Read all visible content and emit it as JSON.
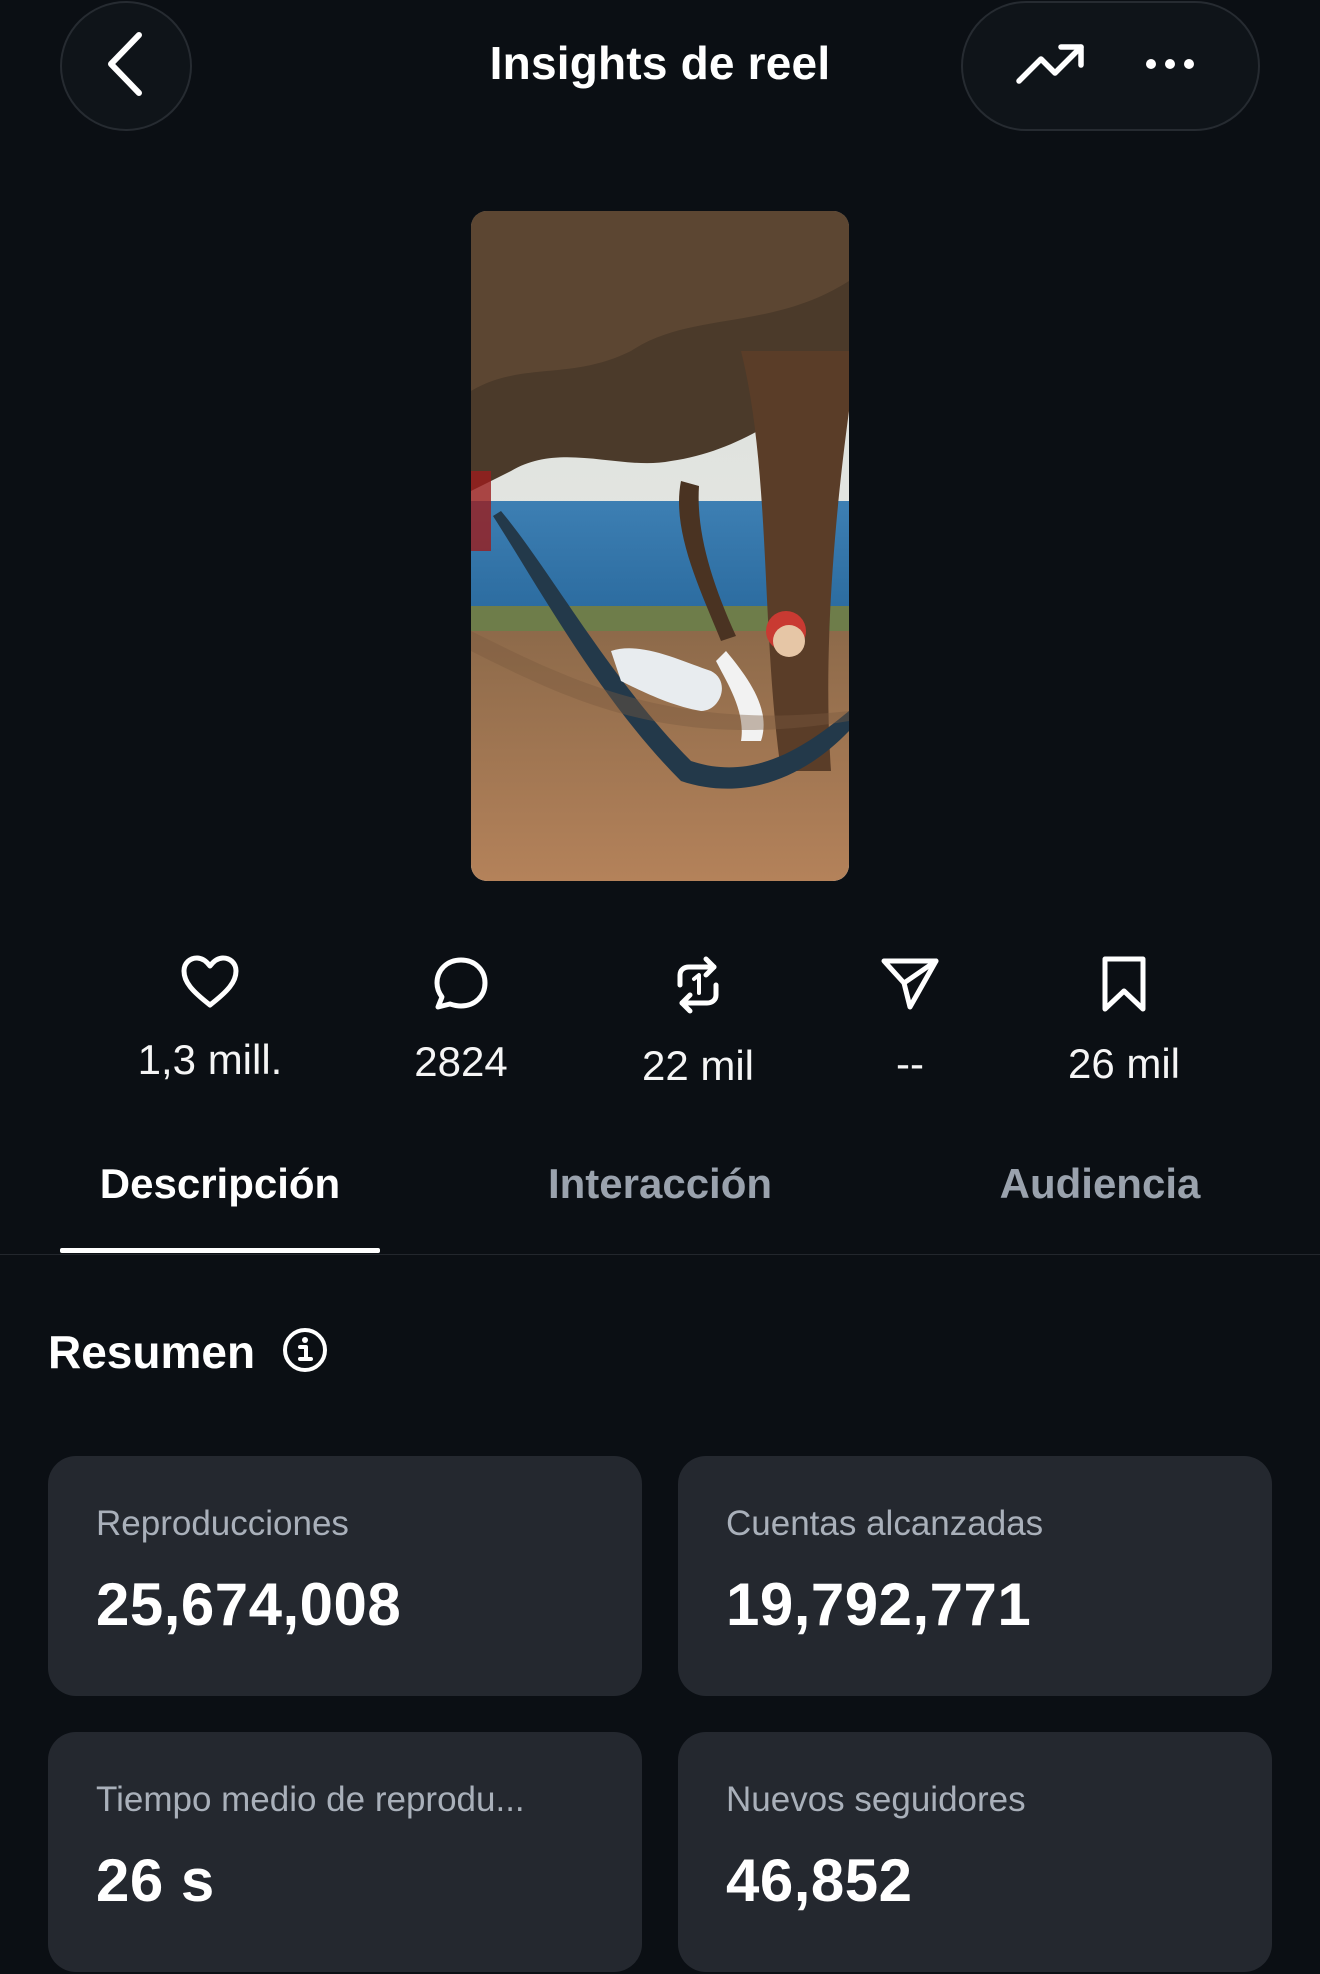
{
  "header": {
    "title": "Insights de reel",
    "back_icon": "chevron-left-icon",
    "trend_icon": "trending-up-icon",
    "more_icon": "more-horizontal-icon"
  },
  "thumbnail": {
    "icon": "reel-thumbnail-hammock-beach"
  },
  "stats": [
    {
      "icon": "heart-icon",
      "value": "1,3 mill."
    },
    {
      "icon": "comment-icon",
      "value": "2824"
    },
    {
      "icon": "repost-icon",
      "value": "22 mil"
    },
    {
      "icon": "send-icon",
      "value": "--"
    },
    {
      "icon": "bookmark-icon",
      "value": "26 mil"
    }
  ],
  "tabs": [
    {
      "label": "Descripción",
      "active": true
    },
    {
      "label": "Interacción",
      "active": false
    },
    {
      "label": "Audiencia",
      "active": false
    }
  ],
  "summary": {
    "title": "Resumen",
    "info_icon": "info-icon",
    "cards": [
      {
        "label": "Reproducciones",
        "value": "25,674,008"
      },
      {
        "label": "Cuentas alcanzadas",
        "value": "19,792,771"
      },
      {
        "label": "Tiempo medio de reprodu...",
        "value": "26 s"
      },
      {
        "label": "Nuevos seguidores",
        "value": "46,852"
      }
    ]
  },
  "colors": {
    "background": "#0b0f14",
    "card": "#24282f",
    "text_primary": "#ffffff",
    "text_secondary": "#a9b0ba"
  }
}
